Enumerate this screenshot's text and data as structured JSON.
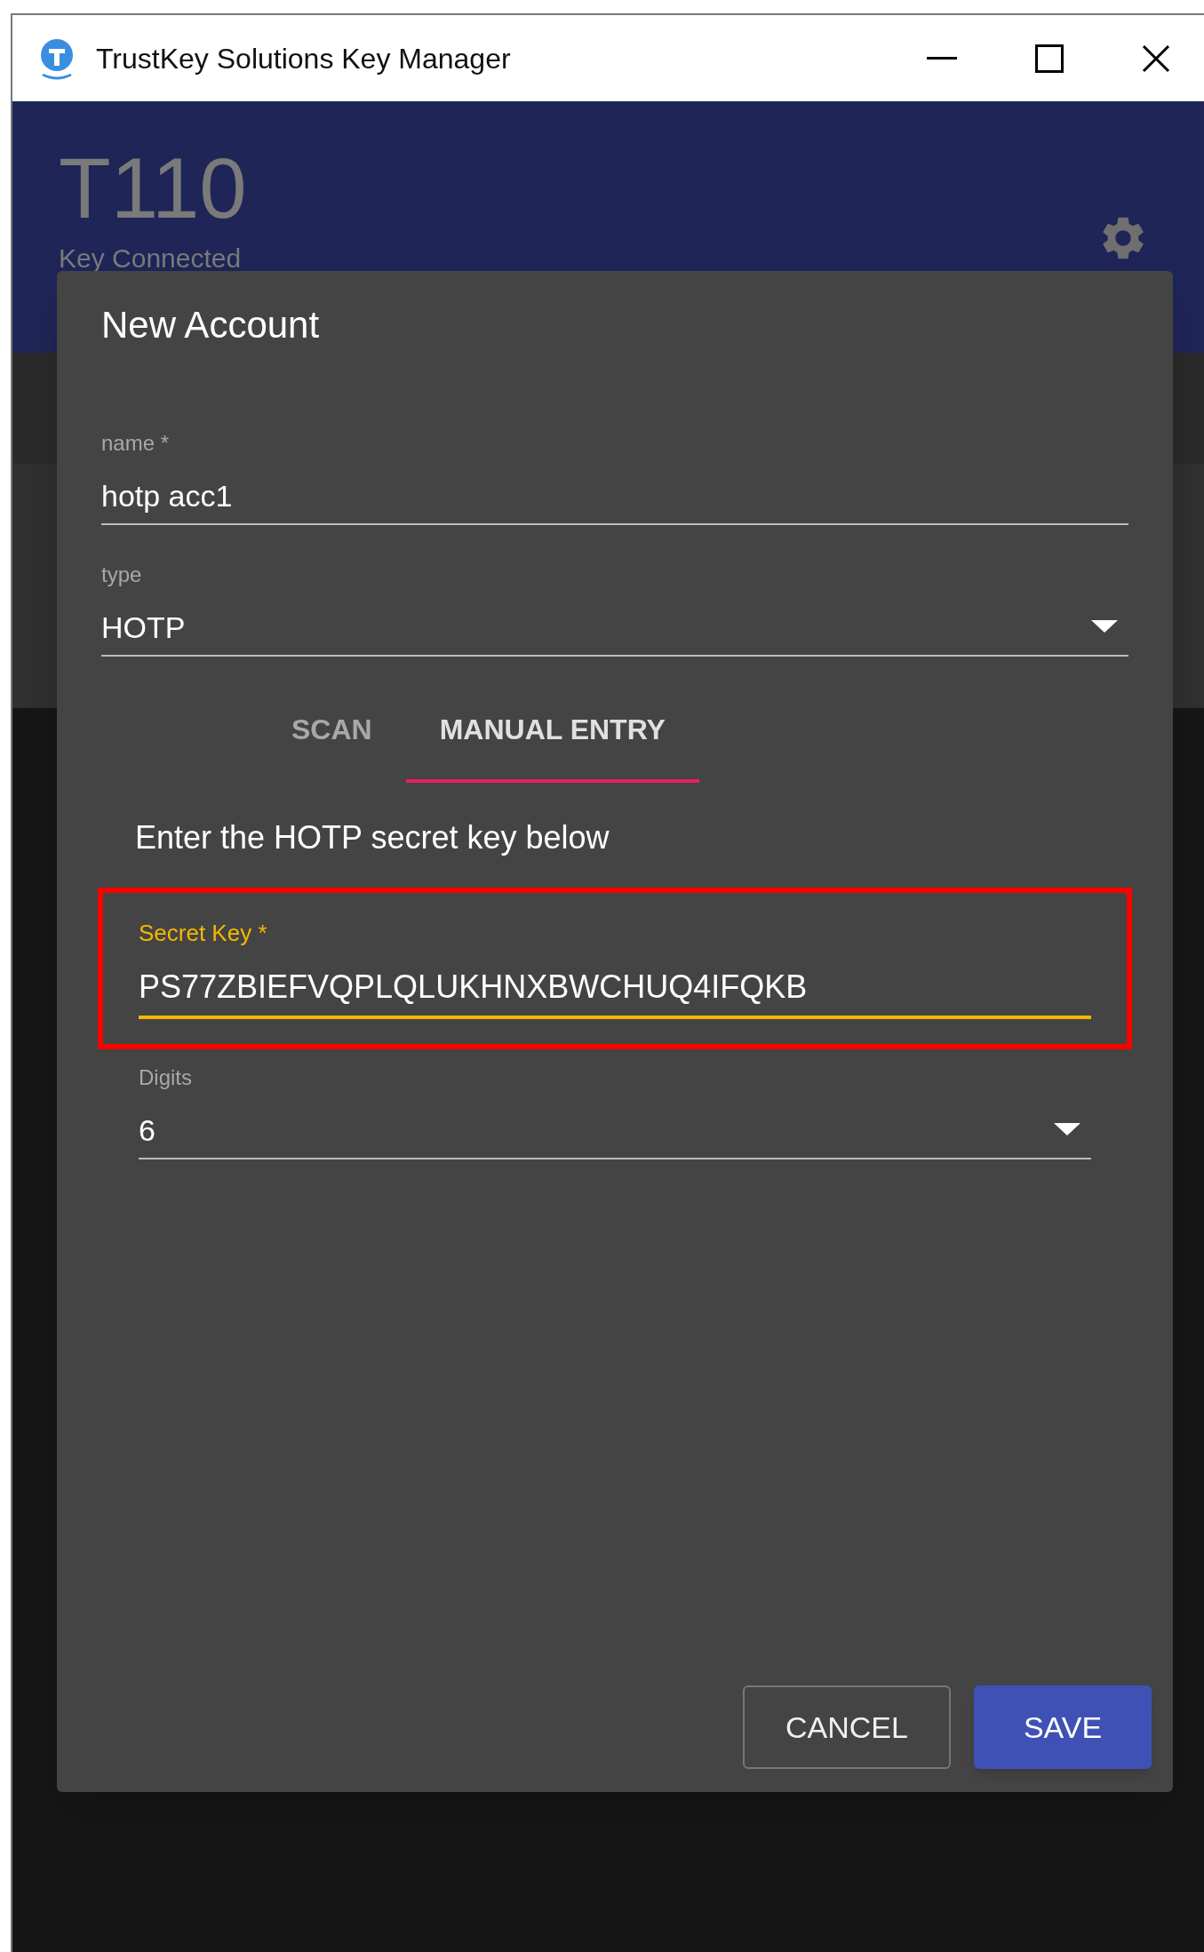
{
  "window": {
    "title": "TrustKey Solutions Key Manager"
  },
  "header": {
    "device": "T110",
    "status": "Key Connected"
  },
  "dialog": {
    "title": "New Account",
    "fields": [
      {
        "kind": "text",
        "label": "name *",
        "value": "hotp acc1"
      },
      {
        "kind": "select",
        "label": "type",
        "value": "HOTP"
      }
    ],
    "tabs": [
      {
        "label": "SCAN",
        "selected": false
      },
      {
        "label": "MANUAL ENTRY",
        "selected": true
      }
    ],
    "instruction": "Enter the HOTP secret key below",
    "secret": {
      "label": "Secret Key *",
      "value": "PS77ZBIEFVQPLQLUKHNXBWCHUQ4IFQKB",
      "focused": true,
      "highlighted": true
    },
    "digits": {
      "kind": "select",
      "label": "Digits",
      "value": "6"
    },
    "buttons": [
      {
        "kind": "outlined",
        "label": "CANCEL"
      },
      {
        "kind": "primary",
        "label": "SAVE"
      }
    ]
  }
}
